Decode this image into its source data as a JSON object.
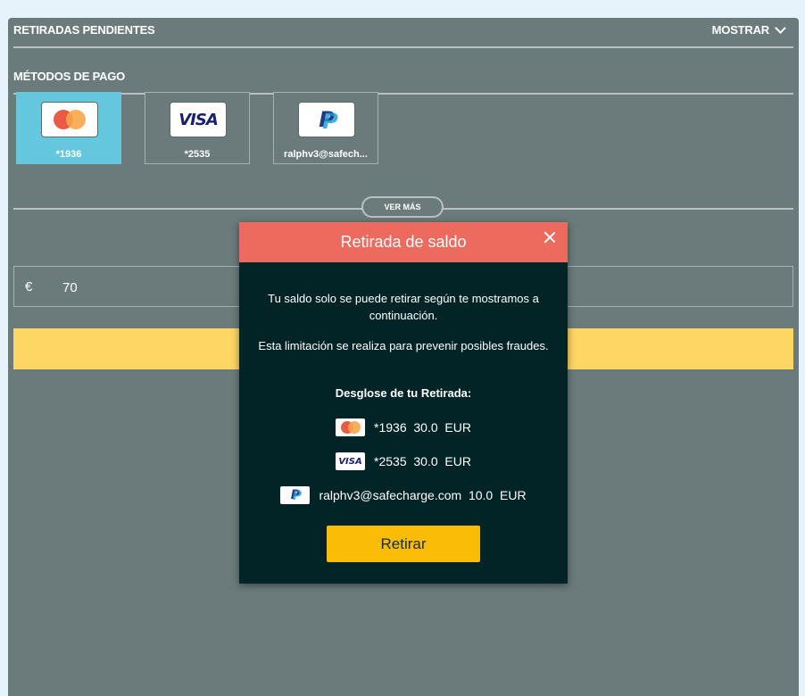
{
  "pending": {
    "label": "RETIRADAS PENDIENTES",
    "show_label": "MOSTRAR"
  },
  "methods": {
    "label": "MÉTODOS DE PAGO",
    "cards": [
      {
        "brand": "mastercard",
        "label": "*1936",
        "selected": true
      },
      {
        "brand": "visa",
        "brand_text": "VISA",
        "label": "*2535",
        "selected": false
      },
      {
        "brand": "paypal",
        "label": "ralphv3@safech...",
        "selected": false
      }
    ],
    "see_more": "VER MÁS"
  },
  "amount": {
    "currency": "€",
    "value": "70"
  },
  "colors": {
    "panel": "#6b7b7c",
    "selected_card": "#64c7dd",
    "yellow_bar": "#fdd663",
    "modal_header": "#ec6a5e",
    "modal_body": "#022427",
    "modal_button": "#fbbc05"
  },
  "modal": {
    "title": "Retirada de saldo",
    "text1": "Tu saldo solo se puede retirar según te mostramos a continuación.",
    "text2": "Esta limitación se realiza para prevenir posibles fraudes.",
    "breakdown_title": "Desglose de tu Retirada:",
    "lines": [
      {
        "brand": "mastercard",
        "id": "*1936",
        "amount": "30.0",
        "currency": "EUR"
      },
      {
        "brand": "visa",
        "brand_text": "VISA",
        "id": "*2535",
        "amount": "30.0",
        "currency": "EUR"
      },
      {
        "brand": "paypal",
        "id": "ralphv3@safecharge.com",
        "amount": "10.0",
        "currency": "EUR"
      }
    ],
    "button": "Retirar",
    "close_icon": "close-icon"
  }
}
